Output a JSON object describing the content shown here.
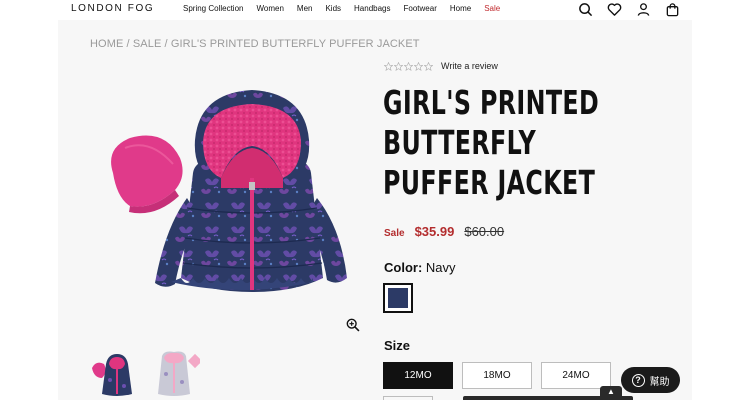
{
  "brand": {
    "logo": "LONDON FOG"
  },
  "nav": {
    "items": [
      {
        "label": "Spring Collection"
      },
      {
        "label": "Women"
      },
      {
        "label": "Men"
      },
      {
        "label": "Kids"
      },
      {
        "label": "Handbags"
      },
      {
        "label": "Footwear"
      },
      {
        "label": "Home"
      },
      {
        "label": "Sale"
      }
    ]
  },
  "header_icons": [
    "search-icon",
    "heart-icon",
    "account-icon",
    "bag-icon"
  ],
  "breadcrumb": {
    "items": [
      {
        "label": "HOME"
      },
      {
        "label": "SALE"
      },
      {
        "label": "GIRL'S PRINTED BUTTERFLY PUFFER JACKET"
      }
    ],
    "separator": " / "
  },
  "reviews": {
    "rating": 0,
    "max": 5,
    "link": "Write a review"
  },
  "product": {
    "title_lines": [
      "GIRL'S PRINTED",
      "BUTTERFLY",
      "PUFFER JACKET"
    ],
    "sale_label": "Sale",
    "price_now": "$35.99",
    "price_was": "$60.00",
    "color_label": "Color:",
    "color_value": "Navy",
    "swatch_color": "#2c3a66",
    "size_label": "Size",
    "sizes": [
      {
        "label": "12MO",
        "selected": true
      },
      {
        "label": "18MO",
        "selected": false
      },
      {
        "label": "24MO",
        "selected": false
      }
    ]
  },
  "help": {
    "label": "幫助"
  },
  "colors": {
    "sale_red": "#b32d2e",
    "jacket_navy": "#2c3a66",
    "fur_pink": "#e0357f"
  }
}
